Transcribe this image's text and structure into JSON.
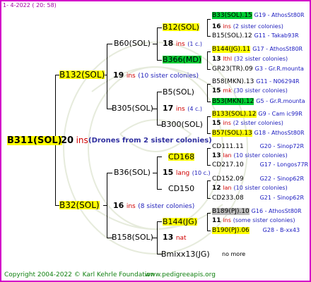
{
  "header": {
    "date": "1-  4-2022 ( 20: 58)"
  },
  "footer": {
    "copyright": "Copyright 2004-2022 © Karl Kehrle Foundation",
    "site": "www.pedigreeapis.org"
  },
  "colors": {
    "frame": "#d300c9",
    "yellow": "#ffff00",
    "green": "#00cc33",
    "gray": "#bbbbbb",
    "ins_red": "#d00000",
    "blue": "#2222bb"
  },
  "root": {
    "name": "B311(SOL)",
    "ins_count": "20",
    "ins_word": "ins",
    "note": "(Drones from 2 sister colonies)"
  },
  "gen1": [
    {
      "name": "B132(SOL)",
      "count": "19",
      "word": "ins",
      "note": "(10 sister colonies)"
    },
    {
      "name": "B32(SOL)",
      "count": "16",
      "word": "ins",
      "note": "(8 sister colonies)"
    }
  ],
  "gen2": [
    {
      "name": "B60(SOL)",
      "count": "18",
      "word": "ins",
      "note": "(1 c.)"
    },
    {
      "name": "B305(SOL)",
      "count": "17",
      "word": "ins",
      "note": "(4 c.)"
    },
    {
      "name": "B36(SOL)",
      "count": "15",
      "word": "lang",
      "note": "(10 c.)"
    },
    {
      "name": "B158(SOL)",
      "count": "13",
      "word": "nat",
      "note": ""
    }
  ],
  "gen3": [
    {
      "name": "B12(SOL)",
      "count": "16",
      "word": "ins",
      "note": "(2 sister colonies)"
    },
    {
      "name": "B366(MD)",
      "count": "13",
      "word": "lthl",
      "note": "(32 sister colonies)"
    },
    {
      "name": "B5(SOL)",
      "count": "15",
      "word": "mk",
      "note": "(30 sister colonies)"
    },
    {
      "name": "B300(SOL)",
      "count": "15",
      "word": "ins",
      "note": "(2 sister colonies)"
    },
    {
      "name": "CD168",
      "count": "13",
      "word": "lan",
      "note": "(10 sister colonies)"
    },
    {
      "name": "CD150",
      "count": "12",
      "word": "lan",
      "note": "(10 sister colonies)"
    },
    {
      "name": "B144(JG)",
      "count": "11",
      "word": "ins",
      "note": "(some sister colonies)"
    },
    {
      "name": "Bmixx13(JG)",
      "count": "",
      "word": "",
      "note": "no more"
    }
  ],
  "gen4": [
    {
      "name": "B33(SOL).15",
      "src": "G19 - AthosSt80R"
    },
    {
      "name": "B15(SOL).12",
      "src": "G11 - Takab93R"
    },
    {
      "name": "B144(JG).11",
      "src": "G17 - AthosSt80R"
    },
    {
      "name": "GR23(TR).09",
      "src": "G3 - Gr.R.mounta"
    },
    {
      "name": "B58(MKN).13",
      "src": "G11 - N06294R"
    },
    {
      "name": "B53(MKN).12",
      "src": "G5 - Gr.R.mounta"
    },
    {
      "name": "B133(SOL).12",
      "src": "G9 - Cam ic99R"
    },
    {
      "name": "B57(SOL).13",
      "src": "G18 - AthosSt80R"
    },
    {
      "name": "CD111.11",
      "src": "G20 - Sinop72R"
    },
    {
      "name": "CD217.10",
      "src": "G17 - Longos77R"
    },
    {
      "name": "CD152.09",
      "src": "G22 - Sinop62R"
    },
    {
      "name": "CD233.08",
      "src": "G21 - Sinop62R"
    },
    {
      "name": "B189(PJ).10",
      "src": "G16 - AthosSt80R"
    },
    {
      "name": "B190(PJ).06",
      "src": "G28 - B-xx43"
    }
  ]
}
